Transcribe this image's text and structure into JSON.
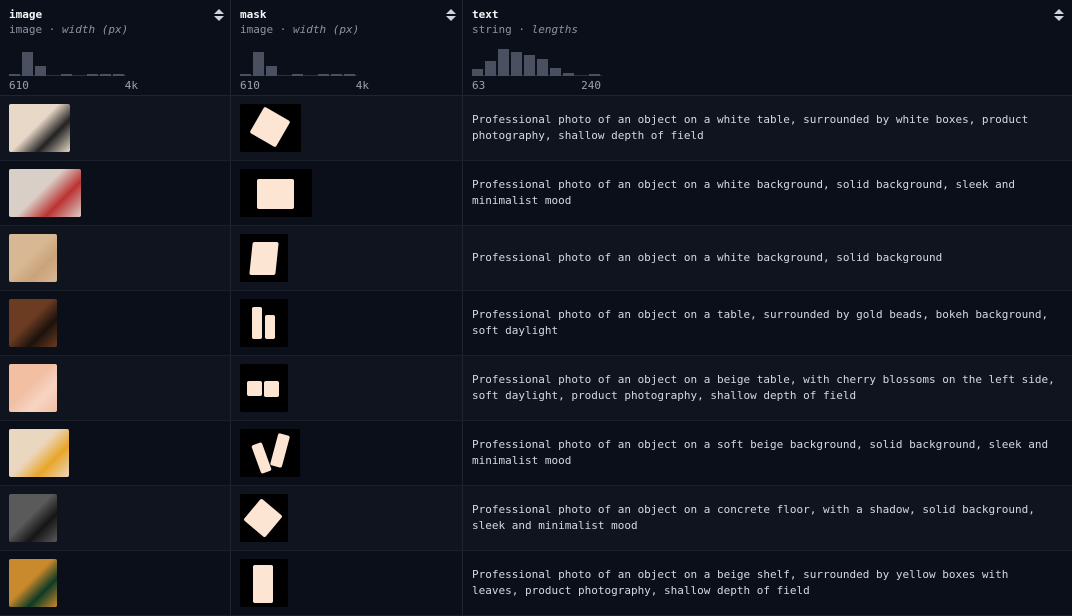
{
  "columns": [
    {
      "title": "image",
      "type": "image",
      "subtitle": "width (px)",
      "range_min": "610",
      "range_max": "4k",
      "hist": [
        0.05,
        0.85,
        0.35,
        0,
        0.05,
        0,
        0.05,
        0.05,
        0.05
      ]
    },
    {
      "title": "mask",
      "type": "image",
      "subtitle": "width (px)",
      "range_min": "610",
      "range_max": "4k",
      "hist": [
        0.05,
        0.85,
        0.35,
        0,
        0.05,
        0,
        0.05,
        0.05,
        0.05
      ]
    },
    {
      "title": "text",
      "type": "string",
      "subtitle": "lengths",
      "range_min": "63",
      "range_max": "240",
      "hist": [
        0.25,
        0.55,
        0.95,
        0.85,
        0.75,
        0.6,
        0.3,
        0.1,
        0,
        0.05
      ]
    }
  ],
  "separator": "·",
  "rows": [
    {
      "text": "Professional photo of an object on a white table, surrounded by white boxes, product photography, shallow depth of field",
      "thumb_color": "#e8d8c8",
      "thumb_accent": "#222",
      "mask_shape": "tilted-square"
    },
    {
      "text": "Professional photo of an object on a white background, solid background, sleek and minimalist mood",
      "thumb_color": "#d9cfc6",
      "thumb_accent": "#b33",
      "mask_shape": "rect-wide"
    },
    {
      "text": "Professional photo of an object on a white background, solid background",
      "thumb_color": "#d8b894",
      "thumb_accent": "#c9a27a",
      "mask_shape": "box"
    },
    {
      "text": "Professional photo of an object on a table, surrounded by gold beads, bokeh background, soft daylight",
      "thumb_color": "#6b3b22",
      "thumb_accent": "#1c120c",
      "mask_shape": "bottles"
    },
    {
      "text": "Professional photo of an object on a beige table, with cherry blossoms on the left side, soft daylight, product photography, shallow depth of field",
      "thumb_color": "#f2bfa3",
      "thumb_accent": "#f7d4c3",
      "mask_shape": "two-jars"
    },
    {
      "text": "Professional photo of an object on a soft beige background, solid background, sleek and minimalist mood",
      "thumb_color": "#ead7c0",
      "thumb_accent": "#e8a628",
      "mask_shape": "two-bottles"
    },
    {
      "text": "Professional photo of an object on a concrete floor, with a shadow, solid background, sleek and minimalist mood",
      "thumb_color": "#5a5a5a",
      "thumb_accent": "#151515",
      "mask_shape": "tilted-bag"
    },
    {
      "text": "Professional photo of an object on a beige shelf, surrounded by yellow boxes with leaves, product photography, shallow depth of field",
      "thumb_color": "#c9892d",
      "thumb_accent": "#0f3a25",
      "mask_shape": "tall-bottle"
    }
  ]
}
